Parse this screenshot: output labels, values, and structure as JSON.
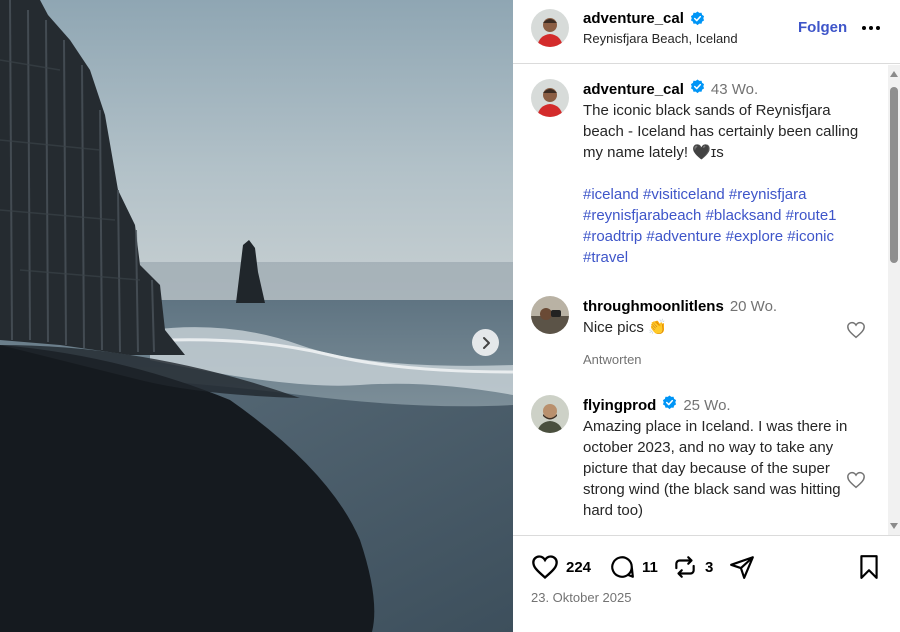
{
  "post": {
    "username": "adventure_cal",
    "location": "Reynisfjara Beach, Iceland",
    "follow_label": "Folgen",
    "caption": {
      "age": "43 Wo.",
      "text": "The iconic black sands of Reynisfjara beach - Iceland has certainly been calling my name lately! 🖤ɪs",
      "hashtags": "#iceland #visiticeland #reynisfjara #reynisfjarabeach #blacksand #route1 #roadtrip #adventure #explore #iconic #travel"
    },
    "date": "23. Oktober 2025"
  },
  "comments": [
    {
      "username": "throughmoonlitlens",
      "age": "20 Wo.",
      "text": "Nice pics 👏",
      "reply_label": "Antworten",
      "verified": false
    },
    {
      "username": "flyingprod",
      "age": "25 Wo.",
      "text": "Amazing place in Iceland. I was there in october 2023, and no way to take any picture that day because of the super strong wind (the black sand was hitting hard too)",
      "verified": true
    }
  ],
  "actions": {
    "likes": "224",
    "comments": "11",
    "reposts": "3"
  },
  "icons": {
    "verified": "verified-badge-icon",
    "more": "more-horizontal-icon",
    "like": "heart-icon",
    "comment": "comment-bubble-icon",
    "repost": "repost-icon",
    "share": "send-icon",
    "save": "bookmark-icon",
    "next": "chevron-right-icon"
  },
  "colors": {
    "link": "#3e55c9",
    "verified": "#0095f6",
    "muted": "#737373"
  }
}
